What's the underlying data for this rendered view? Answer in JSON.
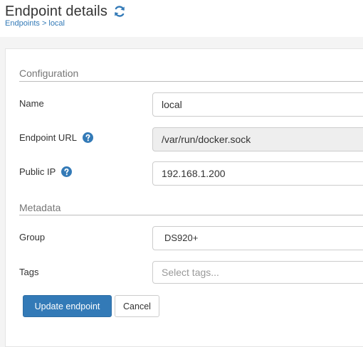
{
  "header": {
    "title": "Endpoint details",
    "refresh_icon": "refresh-icon",
    "breadcrumb": {
      "parent": "Endpoints",
      "separator": ">",
      "current": "local"
    }
  },
  "form": {
    "configuration": {
      "section_title": "Configuration",
      "name": {
        "label": "Name",
        "value": "local"
      },
      "endpoint_url": {
        "label": "Endpoint URL",
        "value": "/var/run/docker.sock",
        "help_icon": "question-circle-icon"
      },
      "public_ip": {
        "label": "Public IP",
        "value": "192.168.1.200",
        "help_icon": "question-circle-icon"
      }
    },
    "metadata": {
      "section_title": "Metadata",
      "group": {
        "label": "Group",
        "value": "DS920+"
      },
      "tags": {
        "label": "Tags",
        "placeholder": "Select tags..."
      }
    },
    "actions": {
      "update_label": "Update endpoint",
      "cancel_label": "Cancel"
    }
  },
  "colors": {
    "accent": "#337ab7",
    "page_background": "#f4f4f4",
    "readonly_input": "#eeeeee"
  }
}
